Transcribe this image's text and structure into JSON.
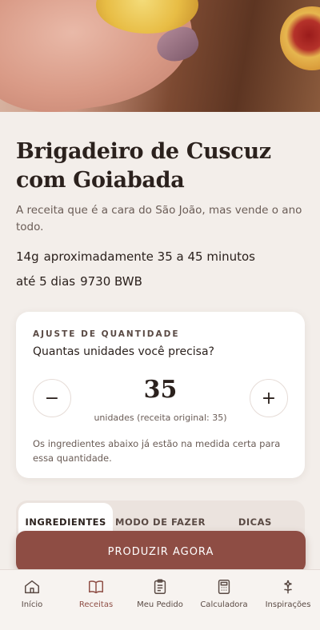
{
  "recipe": {
    "title_line1": "Brigadeiro de Cuscuz",
    "title_line2": "com Goiabada",
    "subtitle": "A receita que é a cara do São João, mas vende o ano todo.",
    "weight": "14g",
    "time": "aproximadamente 35 a 45 minutos",
    "shelf_life": "até 5 dias",
    "code": "9730 BWB"
  },
  "quantity": {
    "label": "AJUSTE DE QUANTIDADE",
    "question": "Quantas unidades você precisa?",
    "minus": "−",
    "plus": "+",
    "value": "35",
    "subtext": "unidades (receita original: 35)",
    "note": "Os ingredientes abaixo já estão na medida certa para essa quantidade."
  },
  "tabs": [
    {
      "label": "INGREDIENTES"
    },
    {
      "label": "MODO DE FAZER"
    },
    {
      "label": "DICAS"
    }
  ],
  "cta": {
    "label": "PRODUZIR AGORA"
  },
  "nav": [
    {
      "label": "Início",
      "icon": "home-icon"
    },
    {
      "label": "Receitas",
      "icon": "book-icon"
    },
    {
      "label": "Meu Pedido",
      "icon": "clipboard-icon"
    },
    {
      "label": "Calculadora",
      "icon": "calculator-icon"
    },
    {
      "label": "Inspirações",
      "icon": "flower-icon"
    }
  ],
  "colors": {
    "accent": "#8e4d44",
    "background": "#f3eeea"
  }
}
